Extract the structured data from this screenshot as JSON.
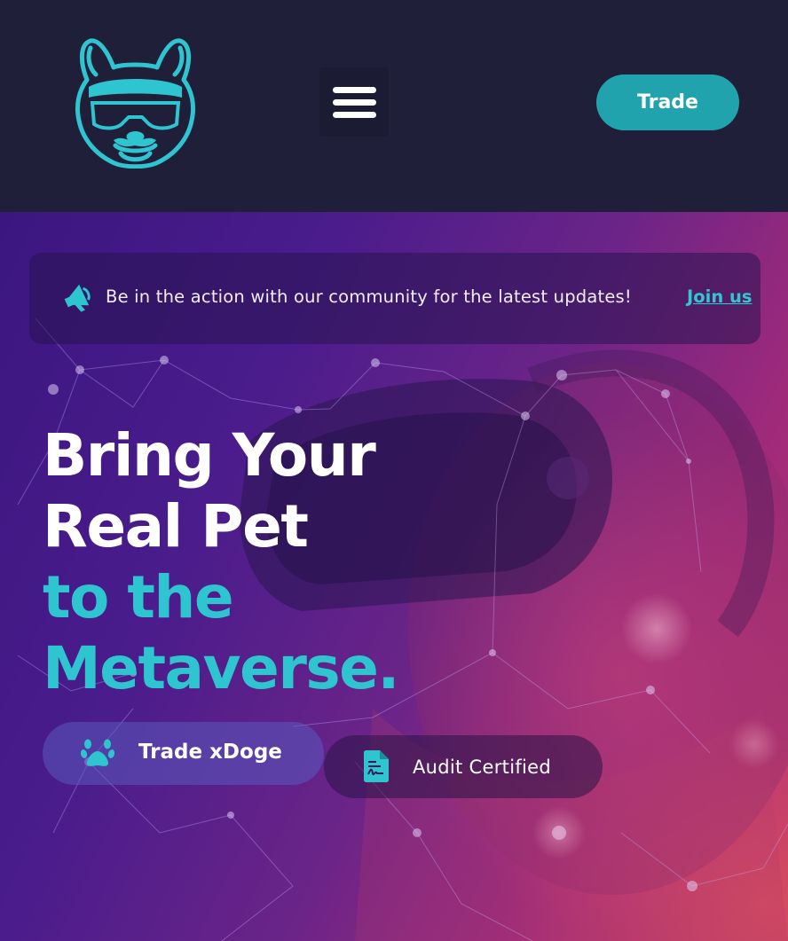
{
  "header": {
    "logo_name": "bulldog-vr-logo",
    "menu_icon": "hamburger-menu-icon",
    "trade_label": "Trade"
  },
  "banner": {
    "icon": "megaphone-icon",
    "message": "Be in the action with our community for the latest updates!",
    "link_label": "Join us"
  },
  "hero": {
    "headline_white_1": "Bring Your",
    "headline_white_2": "Real Pet",
    "headline_cyan_1": "to the",
    "headline_cyan_2": "Metaverse.",
    "primary_cta": {
      "icon": "paw-icon",
      "label": "Trade xDoge"
    },
    "secondary_cta": {
      "icon": "certificate-document-icon",
      "label": "Audit Certified"
    }
  },
  "colors": {
    "header_bg": "#1f1f3a",
    "accent_cyan": "#2ec4d0",
    "trade_button": "#21a3ae",
    "white": "#ffffff"
  }
}
